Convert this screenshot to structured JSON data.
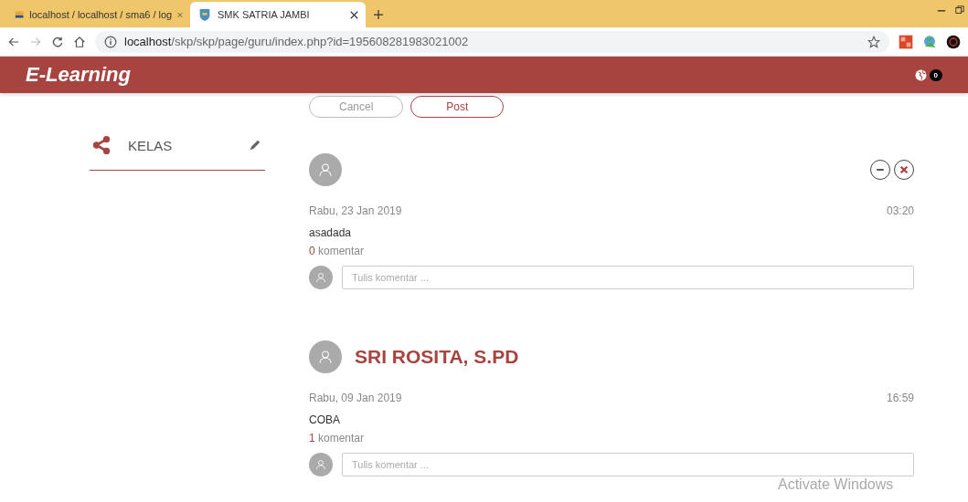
{
  "browser": {
    "tabs": [
      {
        "title": "localhost / localhost / sma6 / log",
        "selected": false
      },
      {
        "title": "SMK SATRIA JAMBI",
        "selected": true
      }
    ],
    "address": {
      "host": "localhost",
      "path": "/skp/skp/page/guru/index.php?id=195608281983021002"
    }
  },
  "header": {
    "brand": "E-Learning",
    "notification_count": "0"
  },
  "sidebar": {
    "items": [
      {
        "label": "KELAS"
      }
    ]
  },
  "composer": {
    "buttons": [
      {
        "label": "Cancel",
        "kind": "secondary"
      },
      {
        "label": "Post",
        "kind": "primary"
      }
    ]
  },
  "posts": [
    {
      "actions": true,
      "date": "Rabu, 23 Jan 2019",
      "time": "03:20",
      "text": "asadada",
      "comment_count": "0",
      "comment_label": "komentar",
      "comment_placeholder": "Tulis komentar ..."
    },
    {
      "author": "SRI ROSITA, S.PD",
      "actions": false,
      "date": "Rabu, 09 Jan 2019",
      "time": "16:59",
      "text": "COBA",
      "comment_count": "1",
      "comment_label": "komentar",
      "comment_placeholder": "Tulis komentar ..."
    }
  ],
  "os_notice": "Activate Windows"
}
